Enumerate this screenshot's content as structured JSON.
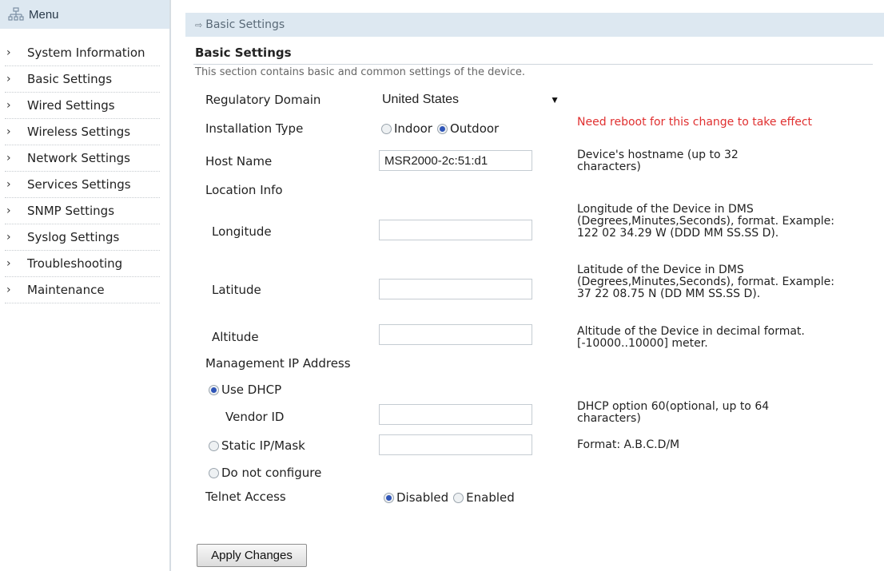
{
  "menu": {
    "title": "Menu",
    "items": [
      "System Information",
      "Basic Settings",
      "Wired Settings",
      "Wireless Settings",
      "Network Settings",
      "Services Settings",
      "SNMP Settings",
      "Syslog Settings",
      "Troubleshooting",
      "Maintenance"
    ]
  },
  "breadcrumb": "Basic Settings",
  "section": {
    "title": "Basic Settings",
    "description": "This section contains basic and common settings of the device."
  },
  "regulatory": {
    "label": "Regulatory Domain",
    "value": "United States"
  },
  "installation": {
    "label": "Installation Type",
    "indoor": "Indoor",
    "outdoor": "Outdoor",
    "help": "Need reboot for this change to take effect"
  },
  "hostname": {
    "label": "Host Name",
    "value": "MSR2000-2c:51:d1",
    "help": "Device's hostname (up to 32 characters)"
  },
  "location": {
    "label": "Location Info",
    "longitude": {
      "label": "Longitude",
      "value": "",
      "help": "Longitude of the Device in DMS (Degrees,Minutes,Seconds), format. Example: 122 02 34.29 W (DDD MM SS.SS D)."
    },
    "latitude": {
      "label": "Latitude",
      "value": "",
      "help": "Latitude of the Device in DMS (Degrees,Minutes,Seconds), format. Example: 37 22 08.75 N (DD MM SS.SS D)."
    },
    "altitude": {
      "label": "Altitude",
      "value": "",
      "help": "Altitude of the Device in decimal format. [-10000..10000] meter."
    }
  },
  "mgmt": {
    "label": "Management IP Address",
    "use_dhcp": "Use DHCP",
    "vendor_id": {
      "label": "Vendor ID",
      "value": "",
      "help": "DHCP option 60(optional, up to 64 characters)"
    },
    "static": {
      "label": "Static IP/Mask",
      "value": "",
      "help": "Format: A.B.C.D/M"
    },
    "none": "Do not configure"
  },
  "telnet": {
    "label": "Telnet Access",
    "disabled": "Disabled",
    "enabled": "Enabled"
  },
  "apply_label": "Apply Changes",
  "colors": {
    "header_bg": "#dde8f1",
    "radio_on": "#2f55b8",
    "warning": "#e03030"
  }
}
